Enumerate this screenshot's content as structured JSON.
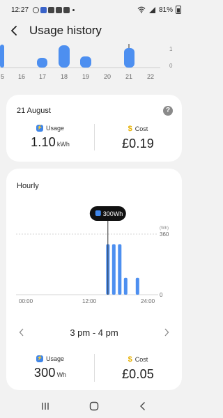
{
  "status_bar": {
    "time": "12:27",
    "battery": "81%"
  },
  "header": {
    "title": "Usage history"
  },
  "daily_chart": {
    "labels": [
      "5",
      "16",
      "17",
      "18",
      "19",
      "20",
      "21",
      "22"
    ],
    "axis": [
      "1",
      "0"
    ],
    "accent": "#4d8ff0"
  },
  "summary": {
    "date": "21 August",
    "help": "?",
    "usage_label": "Usage",
    "usage_value": "1.10",
    "usage_unit": "kWh",
    "cost_label": "Cost",
    "cost_value": "£0.19"
  },
  "hourly": {
    "title": "Hourly",
    "tooltip": "300Wh",
    "unit_label": "(Wh)",
    "y_top": "360",
    "y_bottom": "0",
    "x_labels": [
      "00:00",
      "12:00",
      "24:00"
    ],
    "range": "3 pm - 4 pm",
    "usage_label": "Usage",
    "usage_value": "300",
    "usage_unit": "Wh",
    "cost_label": "Cost",
    "cost_value": "£0.05"
  },
  "chart_data": {
    "type": "bar",
    "title": "Hourly",
    "ylabel": "(Wh)",
    "ylim": [
      0,
      360
    ],
    "x_tick_labels": [
      "00:00",
      "12:00",
      "24:00"
    ],
    "categories": [
      "0",
      "1",
      "2",
      "3",
      "4",
      "5",
      "6",
      "7",
      "8",
      "9",
      "10",
      "11",
      "12",
      "13",
      "14",
      "15",
      "16",
      "17",
      "18",
      "19",
      "20",
      "21",
      "22",
      "23"
    ],
    "values": [
      0,
      0,
      0,
      0,
      0,
      0,
      0,
      0,
      0,
      0,
      0,
      0,
      0,
      0,
      0,
      300,
      300,
      300,
      100,
      0,
      100,
      0,
      0,
      0
    ],
    "selected_index": 15,
    "tooltip": "300Wh"
  }
}
